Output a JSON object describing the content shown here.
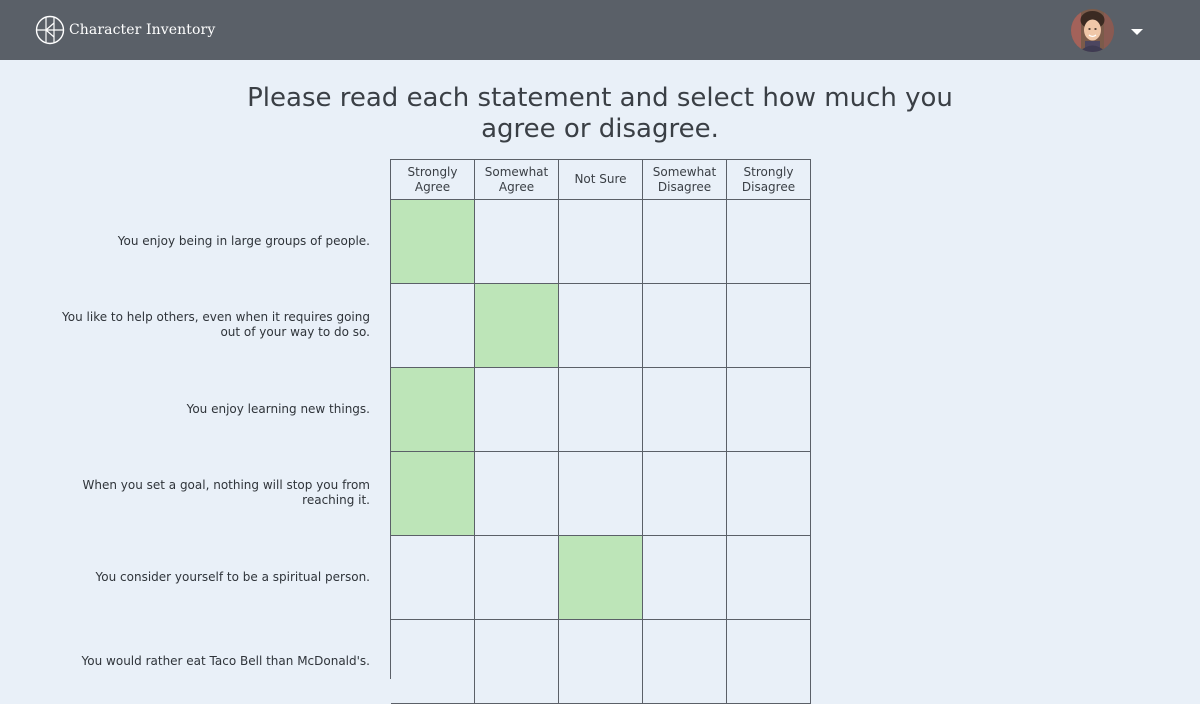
{
  "app": {
    "name": "Character Inventory"
  },
  "colors": {
    "header_bg": "#5a6068",
    "page_bg": "#e9f0f8",
    "selected_cell": "#bde5b8",
    "grid_line": "#5b6068"
  },
  "icons": {
    "logo": "circle-cross-logo-icon",
    "account_menu": "caret-down-icon"
  },
  "heading": {
    "line1": "Please read each statement and select how much you",
    "line2": "agree or disagree."
  },
  "scale": [
    {
      "line1": "Strongly",
      "line2": "Agree"
    },
    {
      "line1": "Somewhat",
      "line2": "Agree"
    },
    {
      "line1": "Not Sure",
      "line2": ""
    },
    {
      "line1": "Somewhat",
      "line2": "Disagree"
    },
    {
      "line1": "Strongly",
      "line2": "Disagree"
    }
  ],
  "statements": [
    {
      "line1": "You enjoy being in large groups of people.",
      "line2": "",
      "selected": 0
    },
    {
      "line1": "You like to help others, even when it requires going",
      "line2": "out of your way to do so.",
      "selected": 1
    },
    {
      "line1": "You enjoy learning new things.",
      "line2": "",
      "selected": 0
    },
    {
      "line1": "When you set a goal, nothing will stop you from",
      "line2": "reaching it.",
      "selected": 0
    },
    {
      "line1": "You consider yourself to be a spiritual person.",
      "line2": "",
      "selected": 2
    },
    {
      "line1": "You would rather eat Taco Bell than McDonald's.",
      "line2": "",
      "selected": null
    }
  ]
}
